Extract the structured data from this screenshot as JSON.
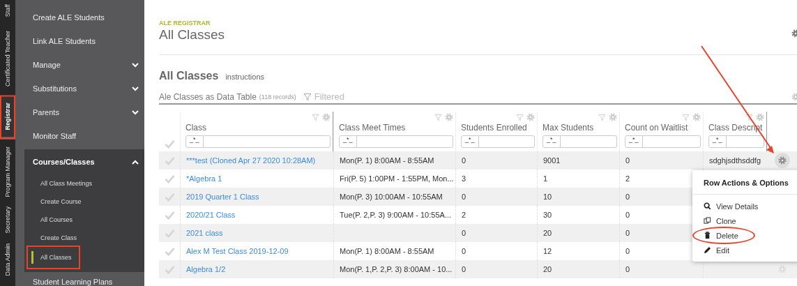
{
  "vertical_tabs": [
    {
      "label": "Staff",
      "selected": false,
      "annotated": false
    },
    {
      "label": "Certificated Teacher",
      "selected": false,
      "annotated": false
    },
    {
      "label": "Registrar",
      "selected": true,
      "annotated": true
    },
    {
      "label": "Program Manager",
      "selected": false,
      "annotated": false
    },
    {
      "label": "Secretary",
      "selected": false,
      "annotated": false
    },
    {
      "label": "Data Admin",
      "selected": false,
      "annotated": false
    }
  ],
  "sidebar": {
    "items": [
      {
        "label": "Create ALE Students",
        "kind": "link"
      },
      {
        "label": "Link ALE Students",
        "kind": "link"
      },
      {
        "label": "Manage",
        "kind": "group",
        "expanded": false
      },
      {
        "label": "Substitutions",
        "kind": "group",
        "expanded": false
      },
      {
        "label": "Parents",
        "kind": "group",
        "expanded": false
      },
      {
        "label": "Monitor Staff",
        "kind": "link"
      },
      {
        "label": "Courses/Classes",
        "kind": "group",
        "expanded": true,
        "children": [
          {
            "label": "All Class Meetings",
            "selected": false,
            "annotated": false
          },
          {
            "label": "Create Course",
            "selected": false,
            "annotated": false
          },
          {
            "label": "All Courses",
            "selected": false,
            "annotated": false
          },
          {
            "label": "Create Class",
            "selected": false,
            "annotated": false
          },
          {
            "label": "All Classes",
            "selected": true,
            "annotated": true
          }
        ]
      },
      {
        "label": "Student Learning Plans",
        "kind": "link"
      }
    ]
  },
  "header": {
    "section": "ALE REGISTRAR",
    "title": "All Classes"
  },
  "panel": {
    "title": "All Classes",
    "instructions_link": "instructions",
    "table_title": "Ale Classes as Data Table",
    "record_count": "(118 records)",
    "filter_status": "Filtered"
  },
  "table": {
    "columns": [
      {
        "label": "Class",
        "filter_mode": "_*_"
      },
      {
        "label": "Class Meet Times",
        "filter_mode": "_*_"
      },
      {
        "label": "Students Enrolled",
        "filter_mode": "_*_"
      },
      {
        "label": "Max Students",
        "filter_mode": "_*_"
      },
      {
        "label": "Count on Waitlist",
        "filter_mode": "_*_"
      },
      {
        "label": "Class Descript",
        "filter_mode": "_*_"
      }
    ],
    "rows": [
      {
        "class": "***test (Cloned Apr 27 2020 10:28AM)",
        "meet_times": "Mon(P. 1) 8:00AM - 8:55AM",
        "enrolled": "0",
        "max": "9001",
        "waitlist": "0",
        "description": "sdghjsdthsddfg",
        "menu_open": true,
        "pointed": true
      },
      {
        "class": "*Algebra 1",
        "meet_times": "Fri(P. 5) 1:00PM - 1:55PM, Mon...",
        "enrolled": "3",
        "max": "1",
        "waitlist": "2"
      },
      {
        "class": "2019 Quarter 1 Class",
        "meet_times": "Mon(P. 3) 10:00AM - 10:55AM",
        "enrolled": "0",
        "max": "10",
        "waitlist": "0"
      },
      {
        "class": "2020/21 Class",
        "meet_times": "Tue(P. 2,P. 3) 9:00AM - 10:55A...",
        "enrolled": "2",
        "max": "30",
        "waitlist": "0"
      },
      {
        "class": "2021 class",
        "enrolled": "0",
        "max": "20",
        "waitlist": "0"
      },
      {
        "class": "Alex M Test Class 2019-12-09",
        "meet_times": "Mon(P. 1) 8:00AM - 8:55AM",
        "enrolled": "0",
        "max": "12",
        "waitlist": "0"
      },
      {
        "class": "Algebra 1/2",
        "meet_times": "Mon(P. 1,P. 2,P. 3) 8:00AM - 10...",
        "enrolled": "0",
        "max": "20",
        "waitlist": "0",
        "menu_open": false
      }
    ]
  },
  "row_menu": {
    "title": "Row Actions & Options",
    "items": [
      {
        "label": "View Details",
        "kind": "view",
        "annotated": false
      },
      {
        "label": "Clone",
        "kind": "clone",
        "annotated": false
      },
      {
        "label": "Delete",
        "kind": "delete",
        "annotated": true
      },
      {
        "label": "Edit",
        "kind": "edit",
        "annotated": false
      }
    ]
  }
}
